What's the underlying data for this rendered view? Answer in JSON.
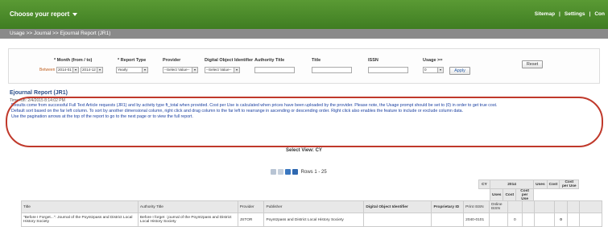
{
  "topbar": {
    "choose_report": "Choose your report",
    "links": [
      "Sitemap",
      "Settings",
      "Con"
    ]
  },
  "breadcrumb": "Usage >>   Journal >>   Ejournal Report (JR1)",
  "filters": {
    "month_label": "* Month (from / to)",
    "between": "Between",
    "month_from": "2014-01",
    "month_to": "2014-12",
    "report_type_label": "* Report Type",
    "report_type_value": "Yearly",
    "provider_label": "Provider",
    "provider_value": "--Select Value--",
    "doi_label": "Digital Object Identifier",
    "doi_value": "--Select Value--",
    "authority_title_label": "Authority Title",
    "title_label": "Title",
    "issn_label": "ISSN",
    "usage_label": "Usage >=",
    "usage_value": "0",
    "apply": "Apply",
    "reset": "Reset"
  },
  "report": {
    "title": "Ejournal Report (JR1)",
    "time": "Time run: 2/4/2015 8:14:02 PM",
    "note_line1": "Results come from successful Full Text Article requests (JR1) and by activity type ft_total when provided. Cost per Use is calculated when prices have been uploaded by the provider. Please note, the Usage prompt should be set to (0) in order to get true cost.",
    "note_line2": "Default sort based on the far left column. To sort by another dimensional column, right click and drag column to the far left to rearrange in ascending or descending order. Right click also enables the feature to include or exclude column data.",
    "note_line3": "Use the pagination arrows at the top of the report to go to the next page or to view the full report.",
    "select_view": "Select View: CY",
    "rows": "Rows 1 - 25"
  },
  "table": {
    "cy": "CY",
    "year": "2014",
    "uses": "Uses",
    "cost": "Cost",
    "cost_per_use": "Cost per Use",
    "headers": [
      "Title",
      "Authority Title",
      "Provider",
      "Publisher",
      "Digital Object Identifier",
      "Proprietary ID",
      "Print ISSN",
      "Online ISSN"
    ],
    "rows": [
      {
        "title": "\"Before I Forget...\": Journal of the Poyntzpass and District Local History Society",
        "authority_title": "Before I forget : journal of the Poyntzpass and District Local History Society",
        "provider": "JSTOR",
        "publisher": "Poyntzpass and District Local History Society",
        "doi": "",
        "proprietary_id": "",
        "print_issn": "2040-0101",
        "online_issn": "",
        "uses_2014": "0",
        "uses_total": "0"
      }
    ]
  }
}
